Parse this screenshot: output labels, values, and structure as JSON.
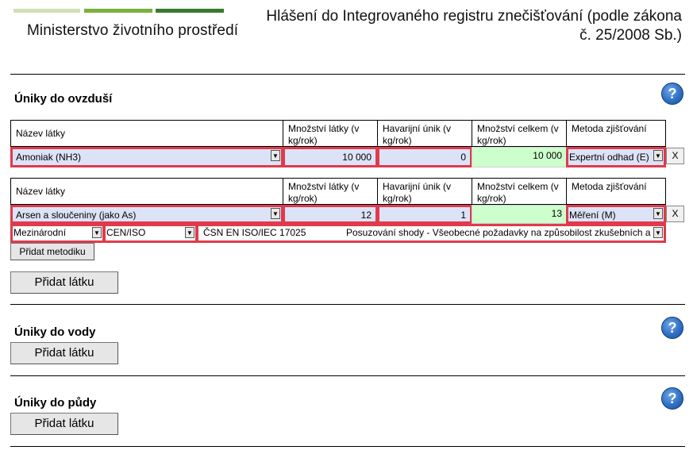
{
  "header": {
    "ministry_name": "Ministerstvo životního prostředí",
    "page_title": "Hlášení do Integrovaného registru znečišťování (podle zákona č. 25/2008 Sb.)"
  },
  "colors": {
    "logo_bar_light": "#cfe0b4",
    "logo_bar_mid": "#7bb03c",
    "logo_bar_dark": "#3a7a2e",
    "field_bg": "#dde3f7",
    "field_border": "#e03a4c",
    "total_bg": "#ccffcc"
  },
  "air": {
    "title": "Úniky do ovzduší",
    "columns": {
      "name": "Název látky",
      "amount": "Množství látky (v kg/rok)",
      "accident": "Havarijní únik (v kg/rok)",
      "total": "Množství celkem (v kg/rok)",
      "method": "Metoda zjišťování"
    },
    "substances": [
      {
        "name": "Amoniak (NH3)",
        "amount": "10 000",
        "accident": "0",
        "total": "10 000",
        "method": "Expertní odhad (E)"
      },
      {
        "name": "Arsen a sloučeniny (jako As)",
        "amount": "12",
        "accident": "1",
        "total": "13",
        "method": "Měření (M)"
      }
    ],
    "methodology": {
      "scope": "Mezinárodní",
      "org": "CEN/ISO",
      "code": "ČSN EN ISO/IEC 17025",
      "desc": "Posuzování shody - Všeobecné požadavky na způsobilost zkušebních a kalibračních laboratoří"
    },
    "add_method_label": "Přidat metodiku",
    "add_substance_label": "Přidat látku",
    "remove_label": "X"
  },
  "water": {
    "title": "Úniky do vody",
    "add_substance_label": "Přidat látku"
  },
  "soil": {
    "title": "Úniky do půdy",
    "add_substance_label": "Přidat látku"
  },
  "help_glyph": "?",
  "dropdown_glyph": "▼"
}
